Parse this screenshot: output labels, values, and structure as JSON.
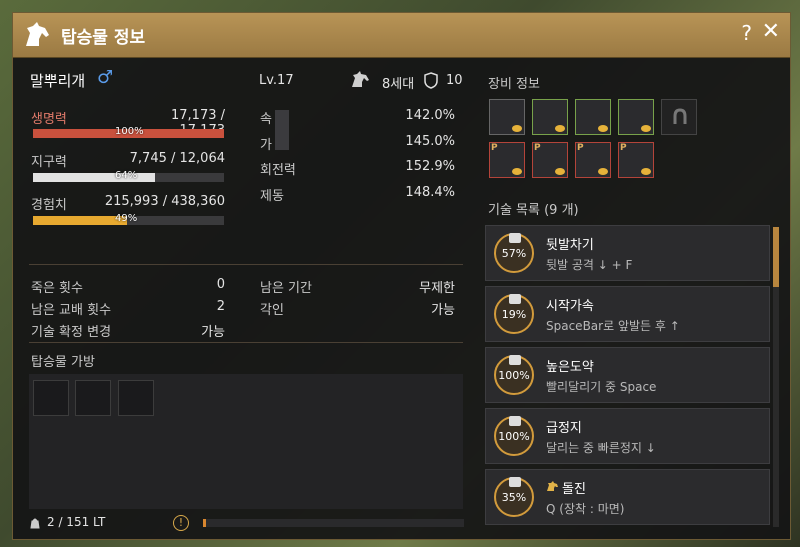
{
  "window": {
    "title": "탑승물 정보",
    "help_label": "?",
    "close_label": "✕"
  },
  "horse": {
    "name": "말뿌리개",
    "gender_icon": "♂",
    "level": "Lv.17",
    "generation": "8세대",
    "armor_value": "10"
  },
  "stats": [
    {
      "label": "생명력",
      "value": "17,173 / 17,173",
      "percent": "100%",
      "fill": 1.0,
      "color": "#c9513d"
    },
    {
      "label": "지구력",
      "value": "7,745 / 12,064",
      "percent": "64%",
      "fill": 0.64,
      "color": "#e2e2e2"
    },
    {
      "label": "경험치",
      "value": "215,993 / 438,360",
      "percent": "49%",
      "fill": 0.49,
      "color": "#e7a930"
    }
  ],
  "attributes": [
    {
      "label": "속",
      "value": "142.0%"
    },
    {
      "label": "가",
      "value": "145.0%"
    },
    {
      "label": "회전력",
      "value": "152.9%"
    },
    {
      "label": "제동",
      "value": "148.4%"
    }
  ],
  "info_left": [
    {
      "label": "죽은 횟수",
      "value": "0"
    },
    {
      "label": "남은 교배 횟수",
      "value": "2"
    },
    {
      "label": "기술 확정 변경",
      "value": "가능"
    }
  ],
  "info_right": [
    {
      "label": "남은 기간",
      "value": "무제한"
    },
    {
      "label": "각인",
      "value": "가능"
    }
  ],
  "inventory": {
    "title": "탑승물 가방",
    "weight": "2 / 151 LT",
    "warning_icon": "!"
  },
  "equipment": {
    "title": "장비 정보",
    "premium_marker": "P"
  },
  "skills": {
    "title": "기술 목록 (9 개)",
    "items": [
      {
        "name": "뒷발차기",
        "desc": "뒷발 공격 ↓ + F",
        "percent": "57%"
      },
      {
        "name": "시작가속",
        "desc": "SpaceBar로 앞발든 후 ↑",
        "percent": "19%"
      },
      {
        "name": "높은도약",
        "desc": "빨리달리기 중 Space",
        "percent": "100%"
      },
      {
        "name": "급정지",
        "desc": "달리는 중 빠른정지 ↓",
        "percent": "100%"
      },
      {
        "name": "돌진",
        "desc": "Q (장착 : 마면)",
        "percent": "35%"
      }
    ]
  },
  "colors": {
    "title_bar": "#b89456",
    "accent": "#d29b3c"
  }
}
